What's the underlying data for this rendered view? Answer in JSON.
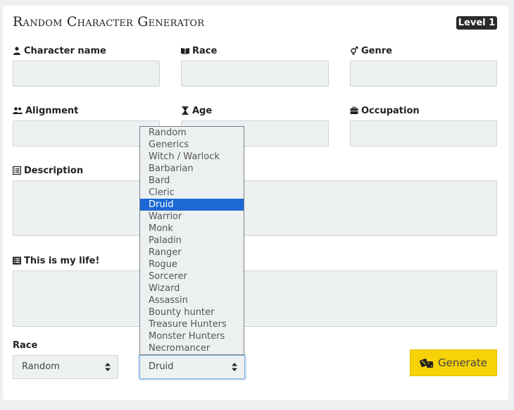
{
  "header": {
    "title": "Random Character Generator",
    "level_badge": "Level 1"
  },
  "fields": {
    "character_name": {
      "label": "Character name",
      "icon": "user-icon",
      "value": ""
    },
    "race": {
      "label": "Race",
      "icon": "book-open-icon",
      "value": ""
    },
    "genre": {
      "label": "Genre",
      "icon": "venus-mars-icon",
      "value": ""
    },
    "alignment": {
      "label": "Alignment",
      "icon": "users-icon",
      "value": ""
    },
    "age": {
      "label": "Age",
      "icon": "hourglass-icon",
      "value": ""
    },
    "occupation": {
      "label": "Occupation",
      "icon": "briefcase-icon",
      "value": ""
    },
    "description": {
      "label": "Description",
      "icon": "list-alt-icon",
      "value": ""
    },
    "life": {
      "label": "This is my life!",
      "icon": "list-icon",
      "value": ""
    }
  },
  "controls": {
    "race_label": "Race",
    "race_select_value": "Random",
    "class_select_value": "Druid",
    "generate_label": "Generate",
    "generate_icon": "dice-icon"
  },
  "dropdown": {
    "selected_index": 6,
    "options": [
      "Random",
      "Generics",
      "Witch / Warlock",
      "Barbarian",
      "Bard",
      "Cleric",
      "Druid",
      "Warrior",
      "Monk",
      "Paladin",
      "Ranger",
      "Rogue",
      "Sorcerer",
      "Wizard",
      "Assassin",
      "Bounty hunter",
      "Treasure Hunters",
      "Monster Hunters",
      "Necromancer"
    ]
  },
  "colors": {
    "accent_generate": "#f6d206",
    "selected_option": "#1c69d4",
    "badge_bg": "#2a2a2a"
  }
}
